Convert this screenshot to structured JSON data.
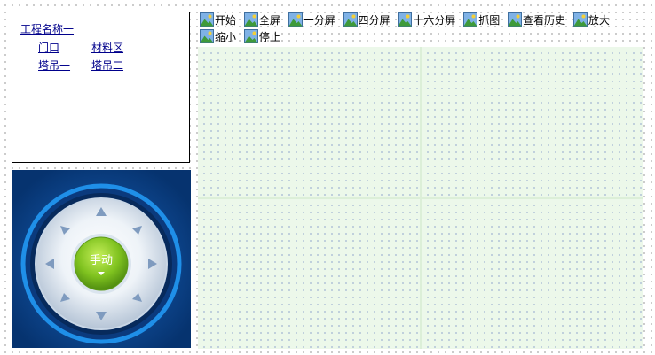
{
  "project": {
    "name": "工程名称一",
    "sites": [
      "门口",
      "材料区",
      "塔吊一",
      "塔吊二"
    ]
  },
  "ptz": {
    "center_label": "手动",
    "center_icon": "chevron-down-icon",
    "directions": [
      "up",
      "up-right",
      "right",
      "down-right",
      "down",
      "down-left",
      "left",
      "up-left"
    ],
    "colors": {
      "panel": "#0a3f87",
      "ring": "#1f8fe8",
      "dial": "#e6eef5",
      "arrow": "#7f9bbf",
      "center": "#79c11f"
    }
  },
  "toolbar": {
    "icon": "image-icon",
    "buttons": [
      "开始",
      "全屏",
      "一分屏",
      "四分屏",
      "十六分屏",
      "抓图",
      "查看历史",
      "放大",
      "缩小",
      "停止"
    ]
  },
  "video_grid": {
    "rows": 2,
    "cols": 2,
    "background": "#ecf8ea"
  }
}
